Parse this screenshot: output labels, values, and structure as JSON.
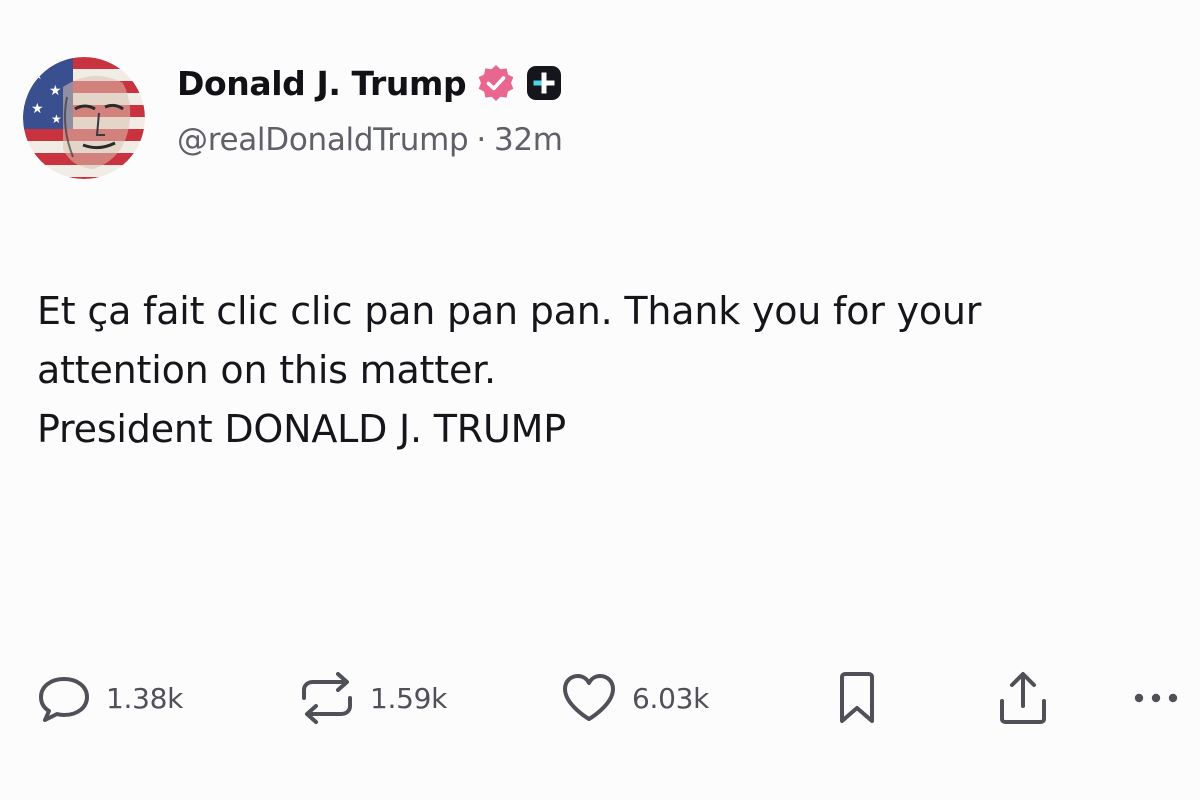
{
  "post": {
    "author": {
      "display_name": "Donald J. Trump",
      "handle": "@realDonaldTrump",
      "separator": "·",
      "time_ago": "32m"
    },
    "body_lines": [
      "Et ça fait clic clic pan pan pan. Thank you for your",
      "attention on this matter.",
      "President DONALD J. TRUMP"
    ],
    "actions": {
      "replies": "1.38k",
      "reposts": "1.59k",
      "likes": "6.03k"
    },
    "icons": {
      "verified": "verified-badge-icon",
      "plus": "plus-badge-icon",
      "reply": "reply-icon",
      "repost": "repost-icon",
      "like": "heart-icon",
      "bookmark": "bookmark-icon",
      "share": "share-icon",
      "more": "more-icon"
    },
    "colors": {
      "verified_badge": "#e8668f",
      "text": "#16151a",
      "muted": "#5f6068"
    }
  }
}
